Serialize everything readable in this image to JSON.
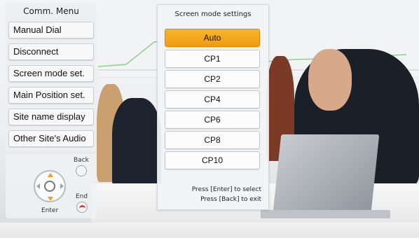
{
  "comm_menu": {
    "title": "Comm. Menu",
    "items": [
      {
        "label": "Manual Dial"
      },
      {
        "label": "Disconnect"
      },
      {
        "label": "Screen mode set."
      },
      {
        "label": "Main Position set."
      },
      {
        "label": "Site name display"
      },
      {
        "label": "Other Site's Audio"
      }
    ]
  },
  "remote": {
    "back_label": "Back",
    "end_label": "End",
    "enter_label": "Enter"
  },
  "screen_mode_dialog": {
    "title": "Screen mode settings",
    "options": [
      "Auto",
      "CP1",
      "CP2",
      "CP4",
      "CP6",
      "CP8",
      "CP10"
    ],
    "selected": "Auto",
    "hint_select": "Press [Enter] to select",
    "hint_exit": "Press [Back] to exit"
  },
  "colors": {
    "selected_accent": "#f3a61c",
    "end_button_red": "#d8412b",
    "dpad_arrow_orange": "#e8a21a"
  },
  "icons": {
    "dpad": "dpad-icon",
    "back_button": "back-button-icon",
    "end_button": "end-call-icon"
  }
}
